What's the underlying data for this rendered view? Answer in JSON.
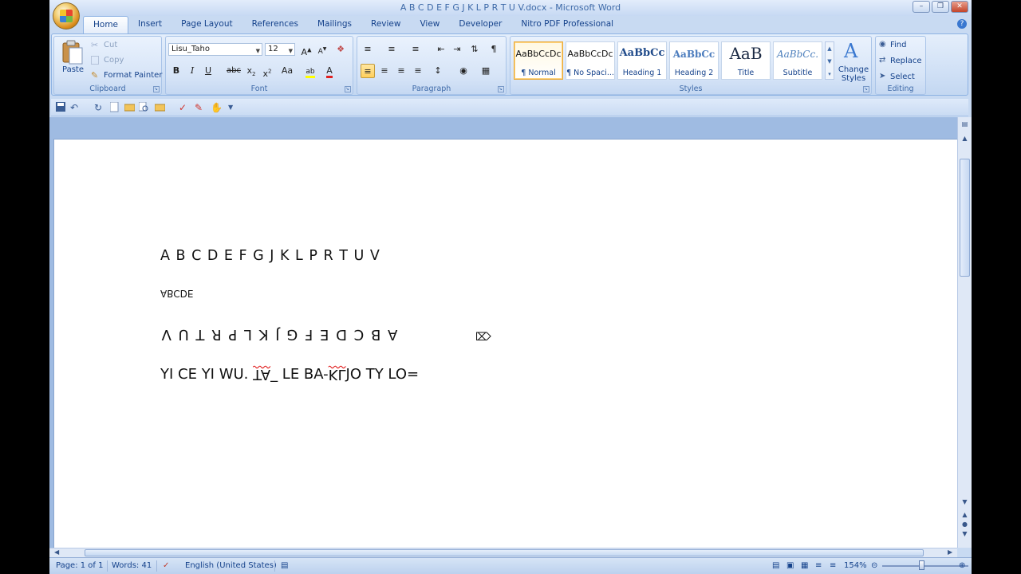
{
  "window": {
    "title": "A B C D E F G J K L P R T U V.docx - Microsoft Word",
    "controls": [
      "minimize",
      "restore",
      "close"
    ]
  },
  "tabs": [
    "Home",
    "Insert",
    "Page Layout",
    "References",
    "Mailings",
    "Review",
    "View",
    "Developer",
    "Nitro PDF Professional"
  ],
  "active_tab": "Home",
  "clipboard": {
    "paste": "Paste",
    "cut": "Cut",
    "copy": "Copy",
    "format_painter": "Format Painter",
    "label": "Clipboard"
  },
  "font": {
    "name": "Lisu_Taho",
    "size": "12",
    "label": "Font",
    "change_case": "Aa"
  },
  "paragraph": {
    "label": "Paragraph"
  },
  "styles": {
    "items": [
      {
        "sample": "AaBbCcDc",
        "name": "¶ Normal",
        "selected": true
      },
      {
        "sample": "AaBbCcDc",
        "name": "¶ No Spaci...",
        "selected": false
      },
      {
        "sample": "AaBbCc",
        "name": "Heading 1",
        "selected": false
      },
      {
        "sample": "AaBbCc",
        "name": "Heading 2",
        "selected": false
      },
      {
        "sample": "AaB",
        "name": "Title",
        "selected": false
      },
      {
        "sample": "AaBbCc.",
        "name": "Subtitle",
        "selected": false
      }
    ],
    "change_styles": "Change Styles",
    "label": "Styles"
  },
  "editing": {
    "find": "Find",
    "replace": "Replace",
    "select": "Select",
    "label": "Editing"
  },
  "document": {
    "lines": [
      "A B C D E F G J K L P R T U V",
      "ABCDE",
      "A B C D E F G J K L P R T U V",
      "YI CE YI WU. TA_ LE BA-KLJO TY LO="
    ],
    "line4_parts": [
      "YI CE YI WU. ",
      "TA",
      "_ LE BA-",
      "KL",
      "JO TY LO="
    ]
  },
  "status": {
    "page": "Page: 1 of 1",
    "words": "Words: 41",
    "language": "English (United States)",
    "zoom": "154%"
  },
  "colors": {
    "ribbon": "#d1e1f6",
    "text": "#15428b",
    "accent": "#ffcf5c"
  }
}
